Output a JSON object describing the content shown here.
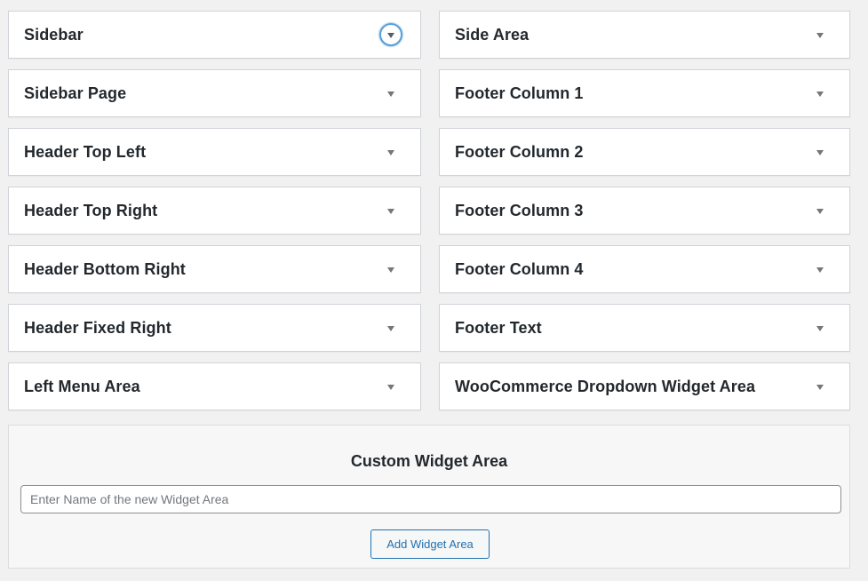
{
  "widget_areas": [
    {
      "title": "Sidebar",
      "toggle_icon": "chevron-down-icon",
      "focused": true
    },
    {
      "title": "Side Area",
      "toggle_icon": "chevron-down-icon",
      "focused": false
    },
    {
      "title": "Sidebar Page",
      "toggle_icon": "chevron-down-icon",
      "focused": false
    },
    {
      "title": "Footer Column 1",
      "toggle_icon": "chevron-down-icon",
      "focused": false
    },
    {
      "title": "Header Top Left",
      "toggle_icon": "chevron-down-icon",
      "focused": false
    },
    {
      "title": "Footer Column 2",
      "toggle_icon": "chevron-down-icon",
      "focused": false
    },
    {
      "title": "Header Top Right",
      "toggle_icon": "chevron-down-icon",
      "focused": false
    },
    {
      "title": "Footer Column 3",
      "toggle_icon": "chevron-down-icon",
      "focused": false
    },
    {
      "title": "Header Bottom Right",
      "toggle_icon": "chevron-down-icon",
      "focused": false
    },
    {
      "title": "Footer Column 4",
      "toggle_icon": "chevron-down-icon",
      "focused": false
    },
    {
      "title": "Header Fixed Right",
      "toggle_icon": "chevron-down-icon",
      "focused": false
    },
    {
      "title": "Footer Text",
      "toggle_icon": "chevron-down-icon",
      "focused": false
    },
    {
      "title": "Left Menu Area",
      "toggle_icon": "chevron-down-icon",
      "focused": false
    },
    {
      "title": "WooCommerce Dropdown Widget Area",
      "toggle_icon": "chevron-down-icon",
      "focused": false
    }
  ],
  "custom_widget_area": {
    "title": "Custom Widget Area",
    "input_placeholder": "Enter Name of the new Widget Area",
    "input_value": "",
    "button_label": "Add Widget Area"
  },
  "colors": {
    "background": "#f1f1f1",
    "panel": "#ffffff",
    "text": "#23282d",
    "focus_ring": "#5b9dd9",
    "button_accent": "#2271b1"
  }
}
